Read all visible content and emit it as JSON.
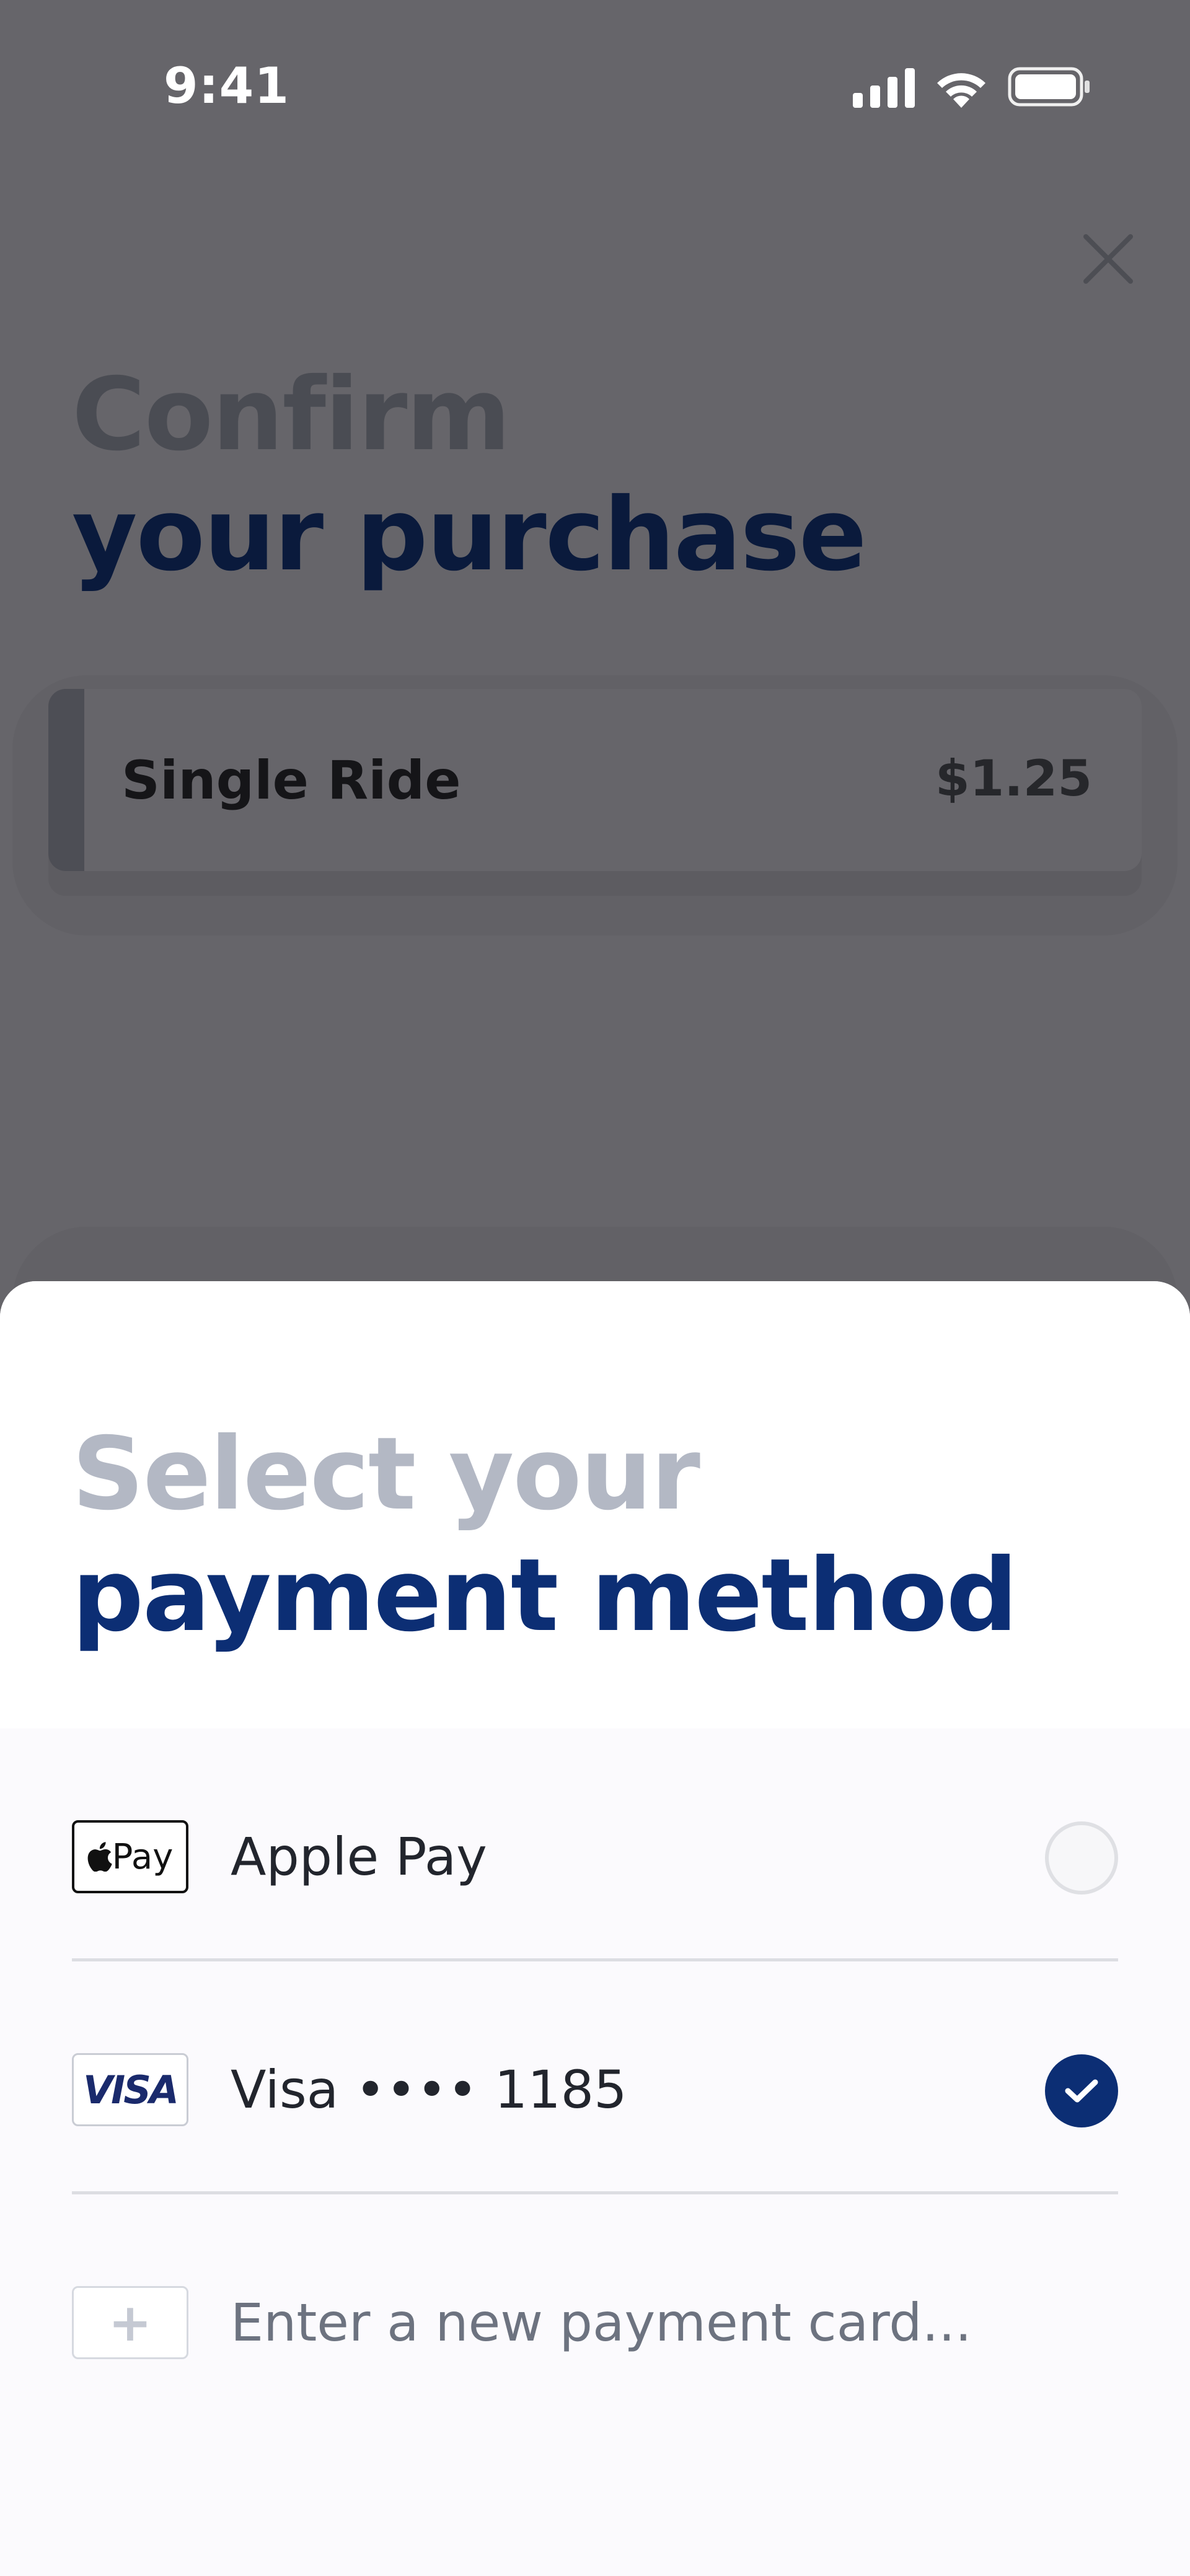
{
  "status_bar": {
    "time": "9:41"
  },
  "background": {
    "title_line1": "Confirm",
    "title_line2": "your purchase",
    "fare": {
      "name": "Single Ride",
      "price": "$1.25"
    },
    "close_icon": "close-icon"
  },
  "sheet": {
    "title_line1": "Select your",
    "title_line2": "payment method",
    "methods": [
      {
        "label": "Apple Pay",
        "badge_text": "Pay",
        "icon": "apple-pay-logo",
        "selected": false
      },
      {
        "label": "Visa •••• 1185",
        "badge_text": "VISA",
        "icon": "visa-logo",
        "selected": true
      }
    ],
    "add_card": {
      "label": "Enter a new payment card...",
      "icon": "plus-icon"
    }
  },
  "colors": {
    "accent": "#0c2e74",
    "overlay": "#66656a",
    "sheet_title_muted": "#b3b8c4"
  }
}
